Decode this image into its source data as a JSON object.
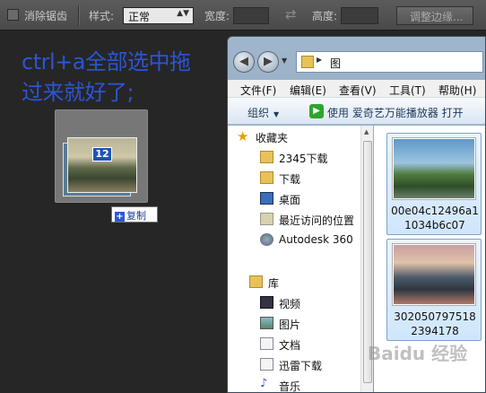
{
  "ps_options": {
    "antialias_label": "消除锯齿",
    "style_label": "样式:",
    "style_value": "正常",
    "width_label": "宽度:",
    "height_label": "高度:",
    "refine_button": "调整边缘..."
  },
  "instruction_text": "ctrl+a全部选中拖过来就好了;",
  "drag": {
    "count": "12",
    "copy_label": "复制"
  },
  "explorer": {
    "path": "图",
    "menu": [
      "文件(F)",
      "编辑(E)",
      "查看(V)",
      "工具(T)",
      "帮助(H)"
    ],
    "toolbar": {
      "organize": "组织",
      "play_label": "使用 爱奇艺万能播放器 打开"
    },
    "nav_items": [
      {
        "label": "收藏夹",
        "icon": "star-icon"
      },
      {
        "label": "2345下载",
        "icon": "folder-icon"
      },
      {
        "label": "下载",
        "icon": "download-folder-icon"
      },
      {
        "label": "桌面",
        "icon": "desktop-icon"
      },
      {
        "label": "最近访问的位置",
        "icon": "recent-places-icon"
      },
      {
        "label": "Autodesk 360",
        "icon": "cloud-icon"
      },
      {
        "label": "库",
        "icon": "library-icon"
      },
      {
        "label": "视频",
        "icon": "video-icon"
      },
      {
        "label": "图片",
        "icon": "pictures-icon"
      },
      {
        "label": "文档",
        "icon": "documents-icon"
      },
      {
        "label": "迅雷下载",
        "icon": "thunder-download-icon"
      },
      {
        "label": "音乐",
        "icon": "music-icon"
      }
    ],
    "files": [
      {
        "name": "00e04c12496a11034b6c07"
      },
      {
        "name": "3020507975182394178"
      }
    ]
  },
  "watermark": "Baidu 经验",
  "colors": {
    "instruction_text": "#2b55d6",
    "selection_blue": "#cfe6fb",
    "ps_background": "#262626"
  }
}
